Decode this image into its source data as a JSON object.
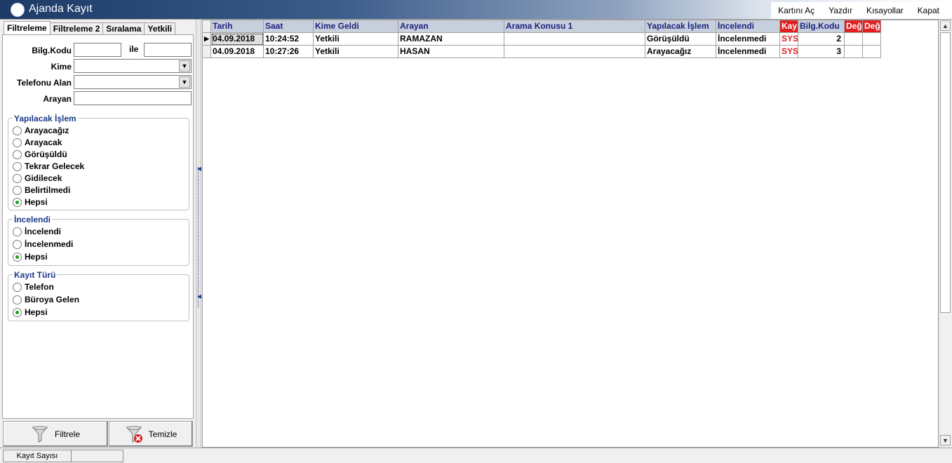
{
  "window": {
    "title": "Ajanda Kayıt"
  },
  "menu": [
    "Kartını Aç",
    "Yazdır",
    "Kısayollar",
    "Kapat"
  ],
  "tabs": [
    "Filtreleme",
    "Filtreleme 2",
    "Sıralama",
    "Yetkili"
  ],
  "filters": {
    "bilg_kodu_label": "Bilg.Kodu",
    "ile_label": "ile",
    "bilg_kodu_from": "",
    "bilg_kodu_to": "",
    "kime_label": "Kime",
    "kime_value": "",
    "telefonu_alan_label": "Telefonu Alan",
    "telefonu_alan_value": "",
    "arayan_label": "Arayan",
    "arayan_value": ""
  },
  "groups": {
    "yapilacak_islem": {
      "title": "Yapılacak İşlem",
      "options": [
        "Arayacağız",
        "Arayacak",
        "Görüşüldü",
        "Tekrar Gelecek",
        "Gidilecek",
        "Belirtilmedi",
        "Hepsi"
      ],
      "selected": "Hepsi"
    },
    "incelendi": {
      "title": "İncelendi",
      "options": [
        "İncelendi",
        "İncelenmedi",
        "Hepsi"
      ],
      "selected": "Hepsi"
    },
    "kayit_turu": {
      "title": "Kayıt Türü",
      "options": [
        "Telefon",
        "Büroya Gelen",
        "Hepsi"
      ],
      "selected": "Hepsi"
    }
  },
  "buttons": {
    "filter": "Filtrele",
    "clear": "Temizle"
  },
  "grid": {
    "columns": [
      "Tarih",
      "Saat",
      "Kime Geldi",
      "Arayan",
      "Arama Konusu 1",
      "Yapılacak İşlem",
      "İncelendi",
      "Kay",
      "Bilg.Kodu",
      "Değ",
      "Değ"
    ],
    "rows": [
      [
        "04.09.2018",
        "10:24:52",
        "Yetkili",
        "RAMAZAN",
        "",
        "Görüşüldü",
        "İncelenmedi",
        "SYS",
        "2",
        "",
        ""
      ],
      [
        "04.09.2018",
        "10:27:26",
        "Yetkili",
        "HASAN",
        "",
        "Arayacağız",
        "İncelenmedi",
        "SYS",
        "3",
        "",
        ""
      ]
    ]
  },
  "status": {
    "record_count_label": "Kayıt Sayısı",
    "record_count_value": ""
  },
  "colors": {
    "accent_red": "#e02020",
    "header_blue": "#1a237e",
    "radio_green": "#21a121"
  }
}
